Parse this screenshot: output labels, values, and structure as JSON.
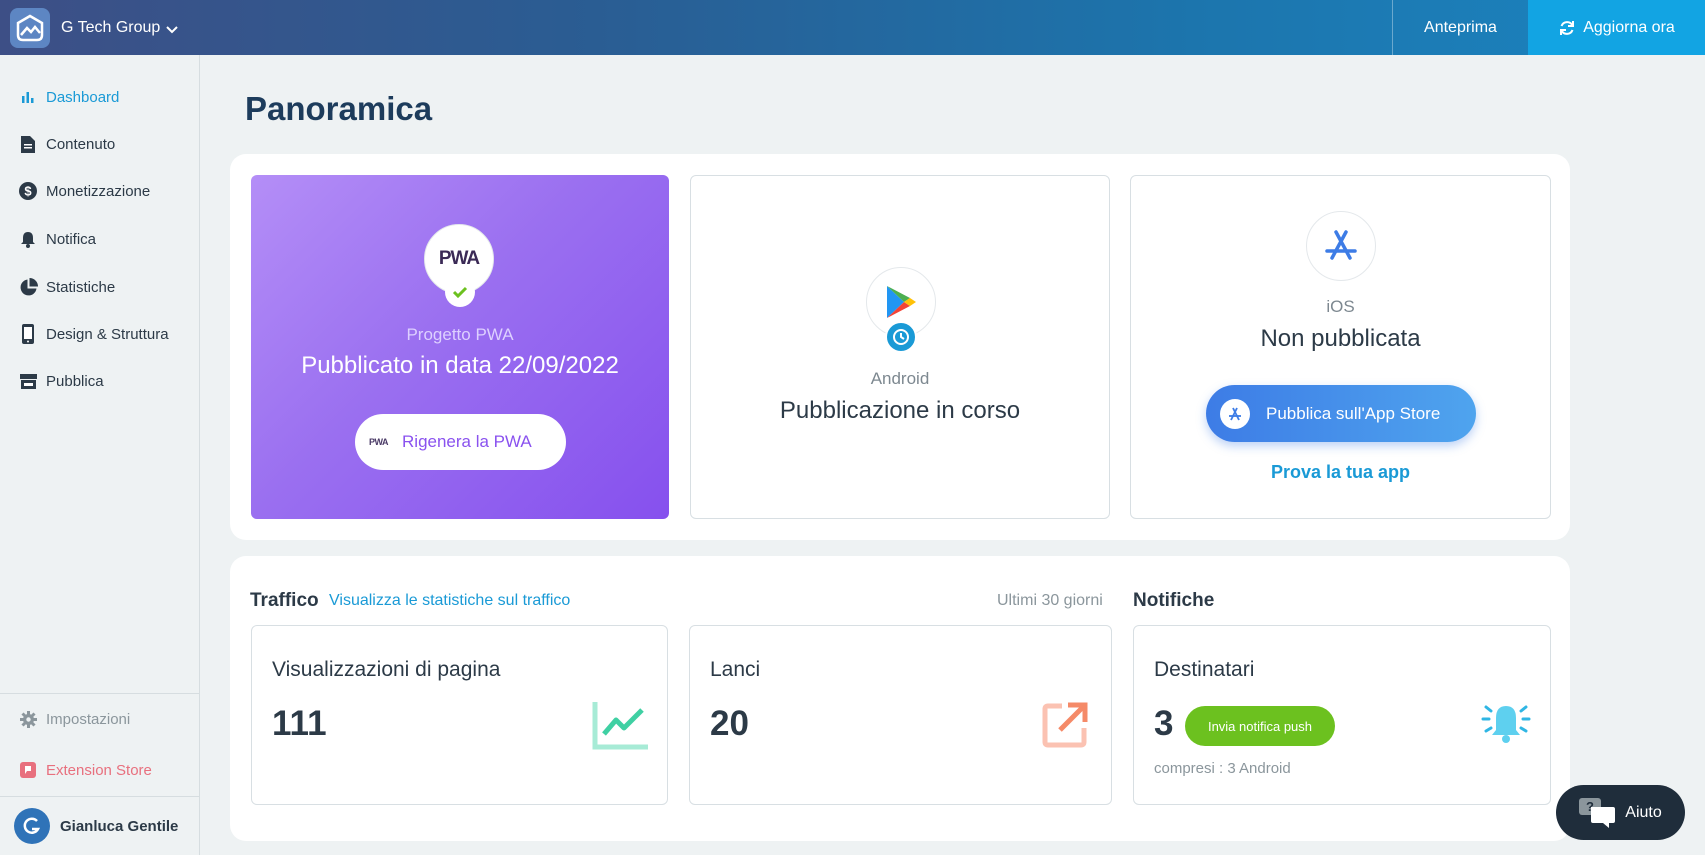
{
  "topbar": {
    "workspace": "G Tech Group",
    "preview_label": "Anteprima",
    "update_label": "Aggiorna ora",
    "accent": "#12a4e3"
  },
  "sidebar": {
    "items": [
      {
        "label": "Dashboard",
        "icon": "bar-chart-icon"
      },
      {
        "label": "Contenuto",
        "icon": "document-icon"
      },
      {
        "label": "Monetizzazione",
        "icon": "dollar-icon"
      },
      {
        "label": "Notifica",
        "icon": "bell-icon"
      },
      {
        "label": "Statistiche",
        "icon": "pie-chart-icon"
      },
      {
        "label": "Design & Struttura",
        "icon": "phone-icon"
      },
      {
        "label": "Pubblica",
        "icon": "store-icon"
      }
    ],
    "settings_label": "Impostazioni",
    "extension_label": "Extension Store",
    "user_name": "Gianluca Gentile"
  },
  "main": {
    "title": "Panoramica",
    "pwa": {
      "logo_text": "PWA",
      "caption": "Progetto PWA",
      "status": "Pubblicato in data 22/09/2022",
      "button_label": "Rigenera la PWA",
      "button_logo_text": "PWA"
    },
    "android": {
      "caption": "Android",
      "status": "Pubblicazione in corso"
    },
    "ios": {
      "caption": "iOS",
      "status": "Non pubblicata",
      "button_label": "Pubblica sull'App Store",
      "link_label": "Prova la tua app"
    },
    "traffic": {
      "title": "Traffico",
      "link": "Visualizza le statistiche sul traffico",
      "range": "Ultimi 30 giorni",
      "page_views_label": "Visualizzazioni di pagina",
      "page_views_value": "111",
      "launches_label": "Lanci",
      "launches_value": "20"
    },
    "notifications": {
      "title": "Notifiche",
      "recipients_label": "Destinatari",
      "recipients_value": "3",
      "push_button": "Invia notifica push",
      "footnote": "compresi : 3 Android"
    }
  },
  "help": {
    "label": "Aiuto"
  }
}
